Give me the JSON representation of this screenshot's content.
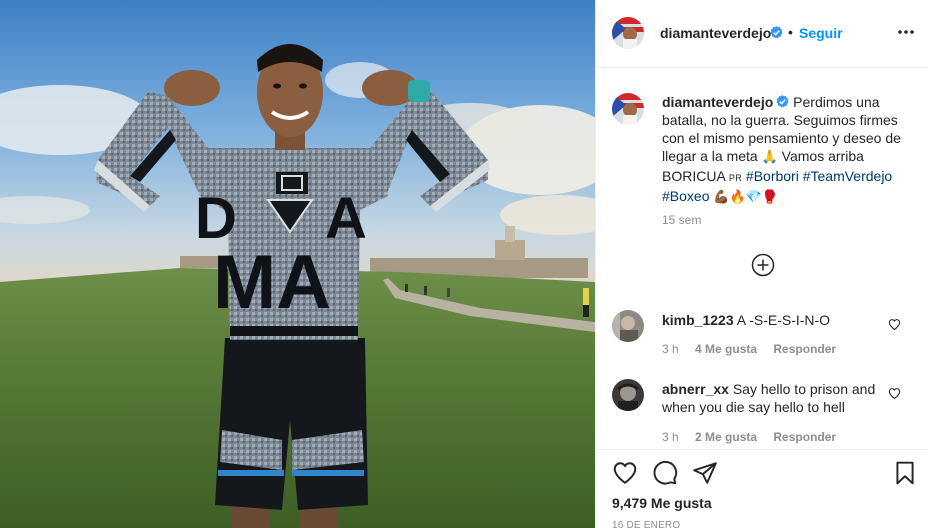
{
  "post": {
    "image_alt": "Boxer flexing arms in front of a fort",
    "shirt_text": "DA MA",
    "author": {
      "username": "diamanteverdejo",
      "verified": true
    },
    "header": {
      "separator": "•",
      "follow_label": "Seguir",
      "more_icon": "more-options-icon"
    },
    "caption": {
      "username": "diamanteverdejo",
      "text_before": " Perdimos una batalla, no la guerra. Seguimos firmes con el mismo pensamiento y deseo de llegar a la meta ",
      "emoji_pray": "🙏",
      "text_after": " Vamos arriba BORICUA ",
      "flag_label": "PR",
      "hashtags": [
        "#Borbori",
        "#TeamVerdejo",
        "#Boxeo"
      ],
      "emoji_trail": "💪🏾🔥💎🥊",
      "time_ago": "15 sem"
    },
    "comments": [
      {
        "username": "kimb_1223",
        "text": "A -S-E-S-I-N-O",
        "time": "3 h",
        "likes": "4 Me gusta",
        "reply_label": "Responder"
      },
      {
        "username": "abnerr_xx",
        "text": "Say hello to prison and when you die say hello to hell",
        "time": "3 h",
        "likes": "2 Me gusta",
        "reply_label": "Responder"
      }
    ],
    "likes_count": "9,479 Me gusta",
    "date": "16 DE ENERO"
  },
  "colors": {
    "accent": "#0095f6",
    "hashtag": "#00376b",
    "muted": "#8e8e8e",
    "text": "#262626"
  }
}
